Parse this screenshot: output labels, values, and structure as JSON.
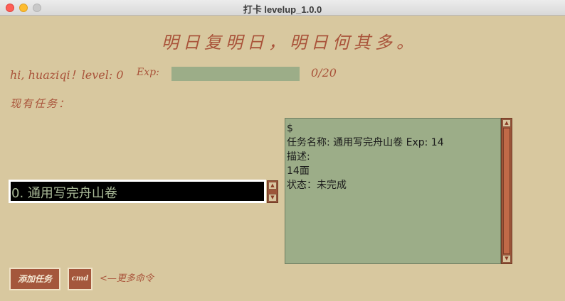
{
  "window": {
    "title": "打卡 levelup_1.0.0"
  },
  "motto": "明日复明日，明日何其多。",
  "user": {
    "greeting": "hi, huaziqi！level: 0",
    "exp_label": "Exp:",
    "exp_count": "0/20",
    "exp_progress": 0
  },
  "tasks": {
    "label": "现有任务：",
    "items": [
      "0. 通用写完舟山卷"
    ]
  },
  "detail": {
    "lines": [
      "$",
      "任务名称: 通用写完舟山卷  Exp: 14",
      "描述:",
      "14面",
      "状态：未完成"
    ]
  },
  "buttons": {
    "add_task": "添加任务",
    "cmd": "cmd"
  },
  "hint": "<—更多命令",
  "colors": {
    "background": "#d8c89f",
    "accent": "#a4573c",
    "panel": "#9cad88",
    "text_accent": "#a9533a"
  }
}
